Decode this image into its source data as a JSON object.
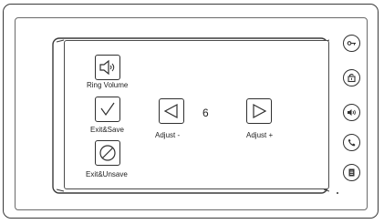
{
  "menu": {
    "ring_volume_label": "Ring Volume",
    "exit_save_label": "Exit&Save",
    "exit_unsave_label": "Exit&Unsave",
    "adjust_minus_label": "Adjust -",
    "adjust_plus_label": "Adjust +",
    "value": "6"
  },
  "side_buttons": [
    {
      "icon": "key-icon"
    },
    {
      "icon": "unlock-icon"
    },
    {
      "icon": "speaker-icon"
    },
    {
      "icon": "phone-icon"
    },
    {
      "icon": "menu-icon"
    }
  ],
  "colors": {
    "outline": "#2f2f2f",
    "background": "#ffffff"
  }
}
